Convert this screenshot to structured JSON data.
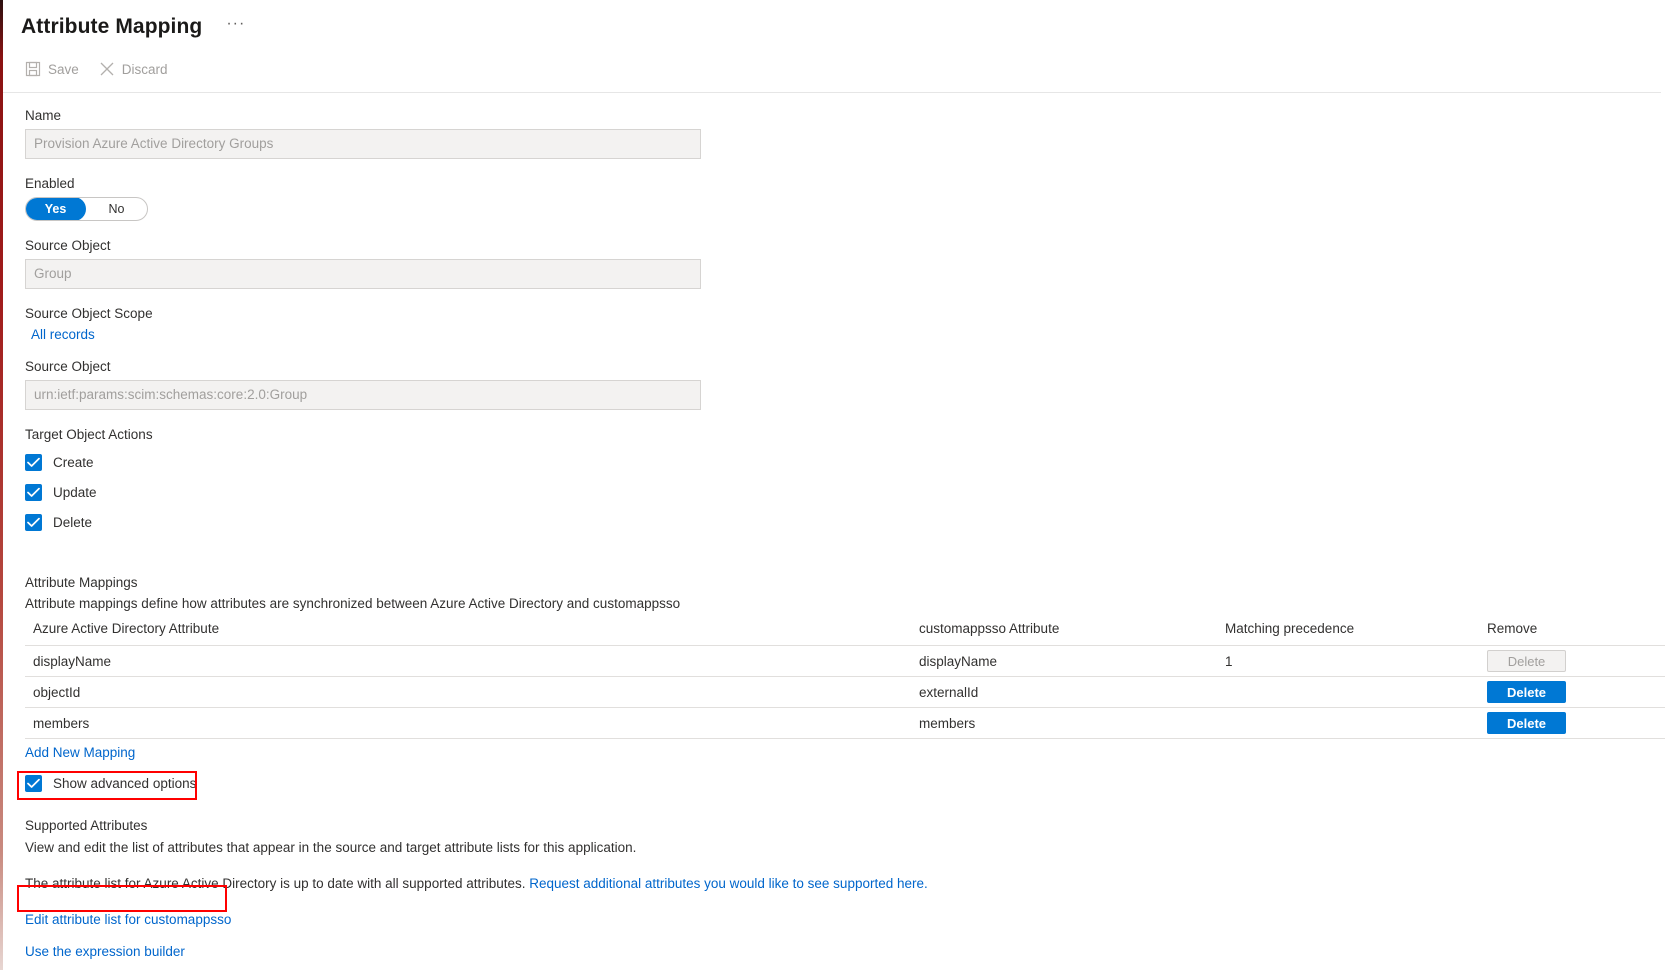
{
  "header": {
    "title": "Attribute Mapping",
    "more_menu": "···"
  },
  "commandbar": {
    "save_label": "Save",
    "save_icon": "save-disk-icon",
    "discard_label": "Discard",
    "discard_icon": "close-x-icon"
  },
  "form": {
    "name_label": "Name",
    "name_value": "Provision Azure Active Directory Groups",
    "enabled_label": "Enabled",
    "toggle_yes": "Yes",
    "toggle_no": "No",
    "toggle_selected": "Yes",
    "source_object_label": "Source Object",
    "source_object_value": "Group",
    "source_object_scope_label": "Source Object Scope",
    "source_object_scope_link": "All records",
    "source_object2_label": "Source Object",
    "source_object2_value": "urn:ietf:params:scim:schemas:core:2.0:Group",
    "target_object_actions_label": "Target Object Actions",
    "actions": [
      {
        "label": "Create",
        "checked": true
      },
      {
        "label": "Update",
        "checked": true
      },
      {
        "label": "Delete",
        "checked": true
      }
    ]
  },
  "mappings": {
    "section_title": "Attribute Mappings",
    "section_desc": "Attribute mappings define how attributes are synchronized between Azure Active Directory and customappsso",
    "columns": [
      "Azure Active Directory Attribute",
      "customappsso Attribute",
      "Matching precedence",
      "Remove"
    ],
    "rows": [
      {
        "source": "displayName",
        "target": "displayName",
        "precedence": "1",
        "action_label": "Delete",
        "action_disabled": true
      },
      {
        "source": "objectId",
        "target": "externalId",
        "precedence": "",
        "action_label": "Delete",
        "action_disabled": false
      },
      {
        "source": "members",
        "target": "members",
        "precedence": "",
        "action_label": "Delete",
        "action_disabled": false
      }
    ],
    "add_new_mapping_link": "Add New Mapping",
    "show_advanced_label": "Show advanced options",
    "show_advanced_checked": true
  },
  "supported": {
    "title": "Supported Attributes",
    "desc": "View and edit the list of attributes that appear in the source and target attribute lists for this application.",
    "status_text": "The attribute list for Azure Active Directory is up to date with all supported attributes. ",
    "request_link": "Request additional attributes you would like to see supported here.",
    "edit_attr_link": "Edit attribute list for customappsso",
    "expression_builder_link": "Use the expression builder"
  },
  "colors": {
    "accent": "#0078d4",
    "link": "#0066cc",
    "annotation": "#ff0000",
    "disabled_text": "#a19f9d",
    "field_bg": "#f3f2f1"
  }
}
